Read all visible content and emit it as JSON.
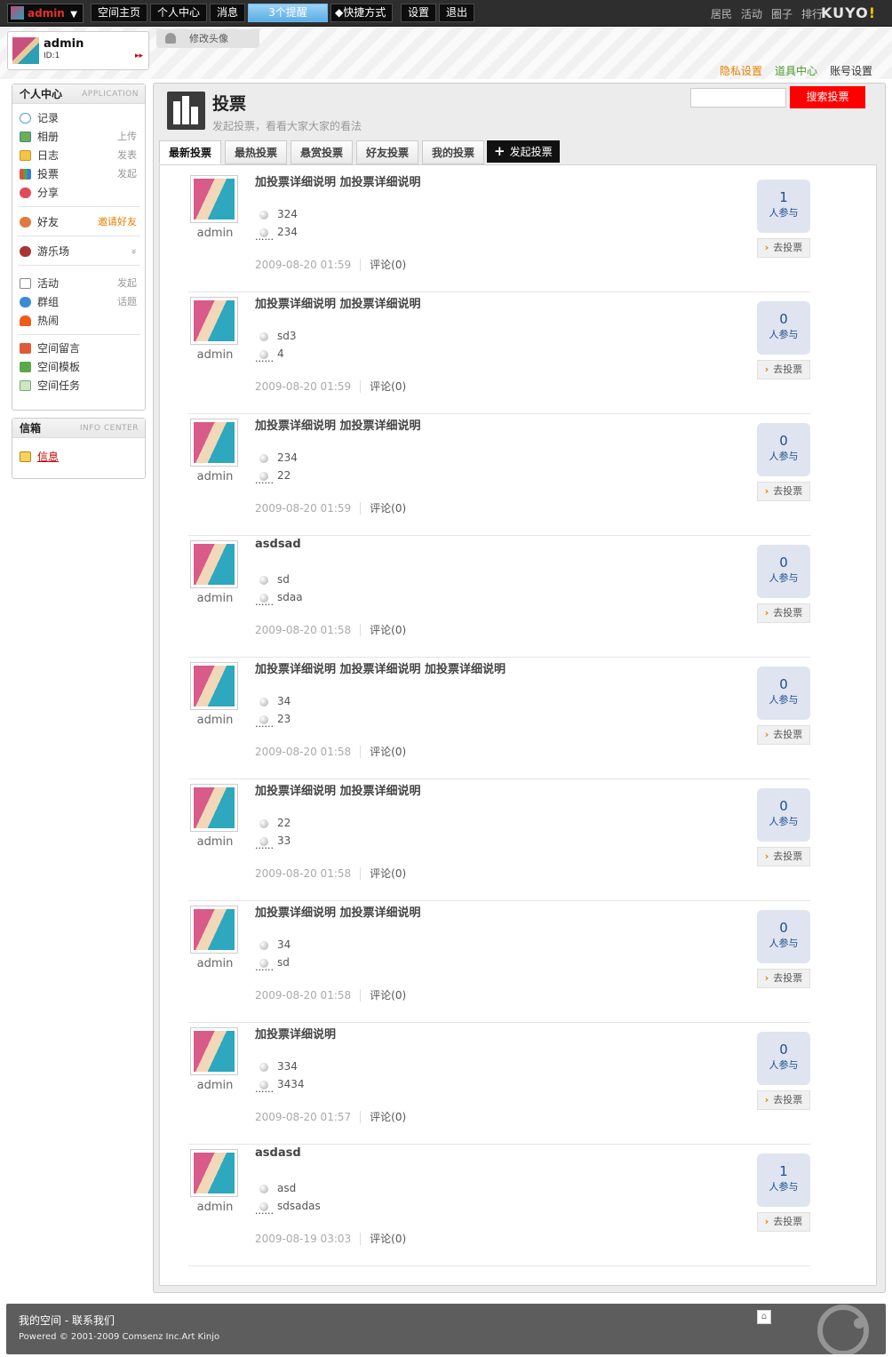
{
  "topbar": {
    "username": "admin",
    "nav": [
      "空间主页",
      "个人中心",
      "消息",
      "3个提醒",
      "快捷方式",
      "设置",
      "退出"
    ],
    "right": [
      "居民",
      "活动",
      "圈子",
      "排行"
    ],
    "logo_main": "KUYO",
    "logo_accent": "!"
  },
  "profile": {
    "name": "admin",
    "id": "ID:1",
    "change_avatar": "修改头像"
  },
  "account_links": [
    "隐私设置",
    "道具中心",
    "账号设置"
  ],
  "sidebar": {
    "title": "个人中心",
    "title_en": "APPLICATION",
    "apps": [
      {
        "label": "记录",
        "extra": ""
      },
      {
        "label": "相册",
        "extra": "上传"
      },
      {
        "label": "日志",
        "extra": "发表"
      },
      {
        "label": "投票",
        "extra": "发起"
      },
      {
        "label": "分享",
        "extra": ""
      }
    ],
    "friend": {
      "label": "好友",
      "extra": "邀请好友"
    },
    "playground": {
      "label": "游乐场",
      "extra": "»"
    },
    "social": [
      {
        "label": "活动",
        "extra": "发起"
      },
      {
        "label": "群组",
        "extra": "话题"
      },
      {
        "label": "热闹",
        "extra": ""
      }
    ],
    "space": [
      {
        "label": "空间留言"
      },
      {
        "label": "空间模板"
      },
      {
        "label": "空间任务"
      }
    ]
  },
  "inbox": {
    "title": "信箱",
    "title_en": "INFO CENTER",
    "link": "信息"
  },
  "page": {
    "title": "投票",
    "subtitle": "发起投票，看看大家大家的看法",
    "search_button": "搜索投票",
    "search_value": ""
  },
  "tabs": [
    "最新投票",
    "最热投票",
    "悬赏投票",
    "好友投票",
    "我的投票"
  ],
  "new_poll": "发起投票",
  "polls": [
    {
      "user": "admin",
      "subject": "加投票详细说明 加投票详细说明",
      "options": [
        "324",
        "234"
      ],
      "more": "......",
      "time": "2009-08-20 01:59",
      "comments": "评论(0)",
      "count": "1",
      "count_label": "人参与",
      "go": "去投票"
    },
    {
      "user": "admin",
      "subject": "加投票详细说明 加投票详细说明",
      "options": [
        "sd3",
        "4"
      ],
      "more": "......",
      "time": "2009-08-20 01:59",
      "comments": "评论(0)",
      "count": "0",
      "count_label": "人参与",
      "go": "去投票"
    },
    {
      "user": "admin",
      "subject": "加投票详细说明 加投票详细说明",
      "options": [
        "234",
        "22"
      ],
      "more": "......",
      "time": "2009-08-20 01:59",
      "comments": "评论(0)",
      "count": "0",
      "count_label": "人参与",
      "go": "去投票"
    },
    {
      "user": "admin",
      "subject": "asdsad",
      "options": [
        "sd",
        "sdaa"
      ],
      "more": "......",
      "time": "2009-08-20 01:58",
      "comments": "评论(0)",
      "count": "0",
      "count_label": "人参与",
      "go": "去投票"
    },
    {
      "user": "admin",
      "subject": "加投票详细说明 加投票详细说明 加投票详细说明",
      "options": [
        "34",
        "23"
      ],
      "more": "......",
      "time": "2009-08-20 01:58",
      "comments": "评论(0)",
      "count": "0",
      "count_label": "人参与",
      "go": "去投票"
    },
    {
      "user": "admin",
      "subject": "加投票详细说明 加投票详细说明",
      "options": [
        "22",
        "33"
      ],
      "more": "......",
      "time": "2009-08-20 01:58",
      "comments": "评论(0)",
      "count": "0",
      "count_label": "人参与",
      "go": "去投票"
    },
    {
      "user": "admin",
      "subject": "加投票详细说明 加投票详细说明",
      "options": [
        "34",
        "sd"
      ],
      "more": "......",
      "time": "2009-08-20 01:58",
      "comments": "评论(0)",
      "count": "0",
      "count_label": "人参与",
      "go": "去投票"
    },
    {
      "user": "admin",
      "subject": "加投票详细说明",
      "options": [
        "334",
        "3434"
      ],
      "more": "......",
      "time": "2009-08-20 01:57",
      "comments": "评论(0)",
      "count": "0",
      "count_label": "人参与",
      "go": "去投票"
    },
    {
      "user": "admin",
      "subject": "asdasd",
      "options": [
        "asd",
        "sdsadas"
      ],
      "more": "......",
      "time": "2009-08-19 03:03",
      "comments": "评论(0)",
      "count": "1",
      "count_label": "人参与",
      "go": "去投票"
    }
  ],
  "footer": {
    "links": "我的空间 - 联系我们",
    "powered": "Powered © 2001-2009 Comsenz Inc.Art Kinjo"
  },
  "colors": {
    "accent_red": "#ff0000",
    "orange": "#e57f00",
    "green": "#4a9a2a",
    "count_blue": "#1d4f8c"
  }
}
